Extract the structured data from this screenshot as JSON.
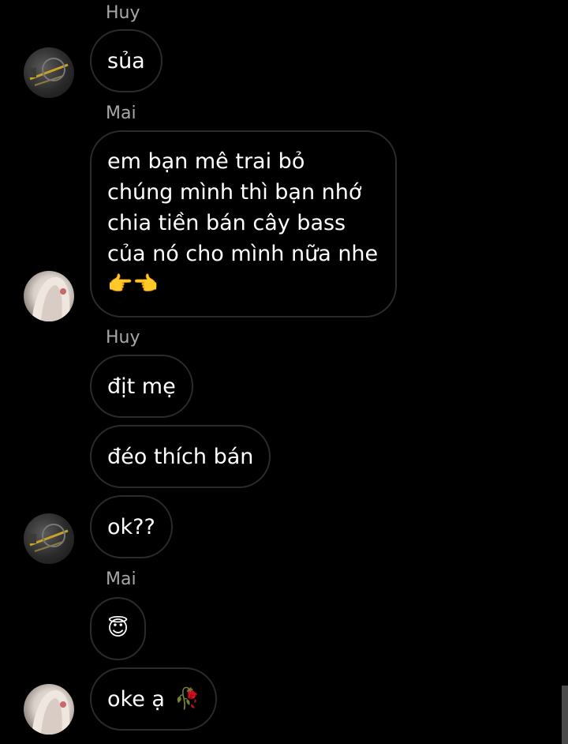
{
  "messages": [
    {
      "sender": "Huy",
      "text": "sủa"
    },
    {
      "sender": "Mai",
      "lines": [
        "em bạn mê trai bỏ",
        "chúng mình thì bạn nhớ",
        "chia tiền bán cây bass",
        "của nó cho mình nữa nhe"
      ],
      "emoji": "👉👈"
    },
    {
      "sender": "Huy",
      "texts": [
        "địt mẹ",
        "đéo thích bán",
        "ok??"
      ]
    },
    {
      "sender": "Mai",
      "emoji": "😇",
      "text": "oke ạ",
      "trailing_emoji": "🥀"
    }
  ],
  "icons": {
    "avatar_huy": "avatar-huy",
    "avatar_mai": "avatar-mai"
  }
}
